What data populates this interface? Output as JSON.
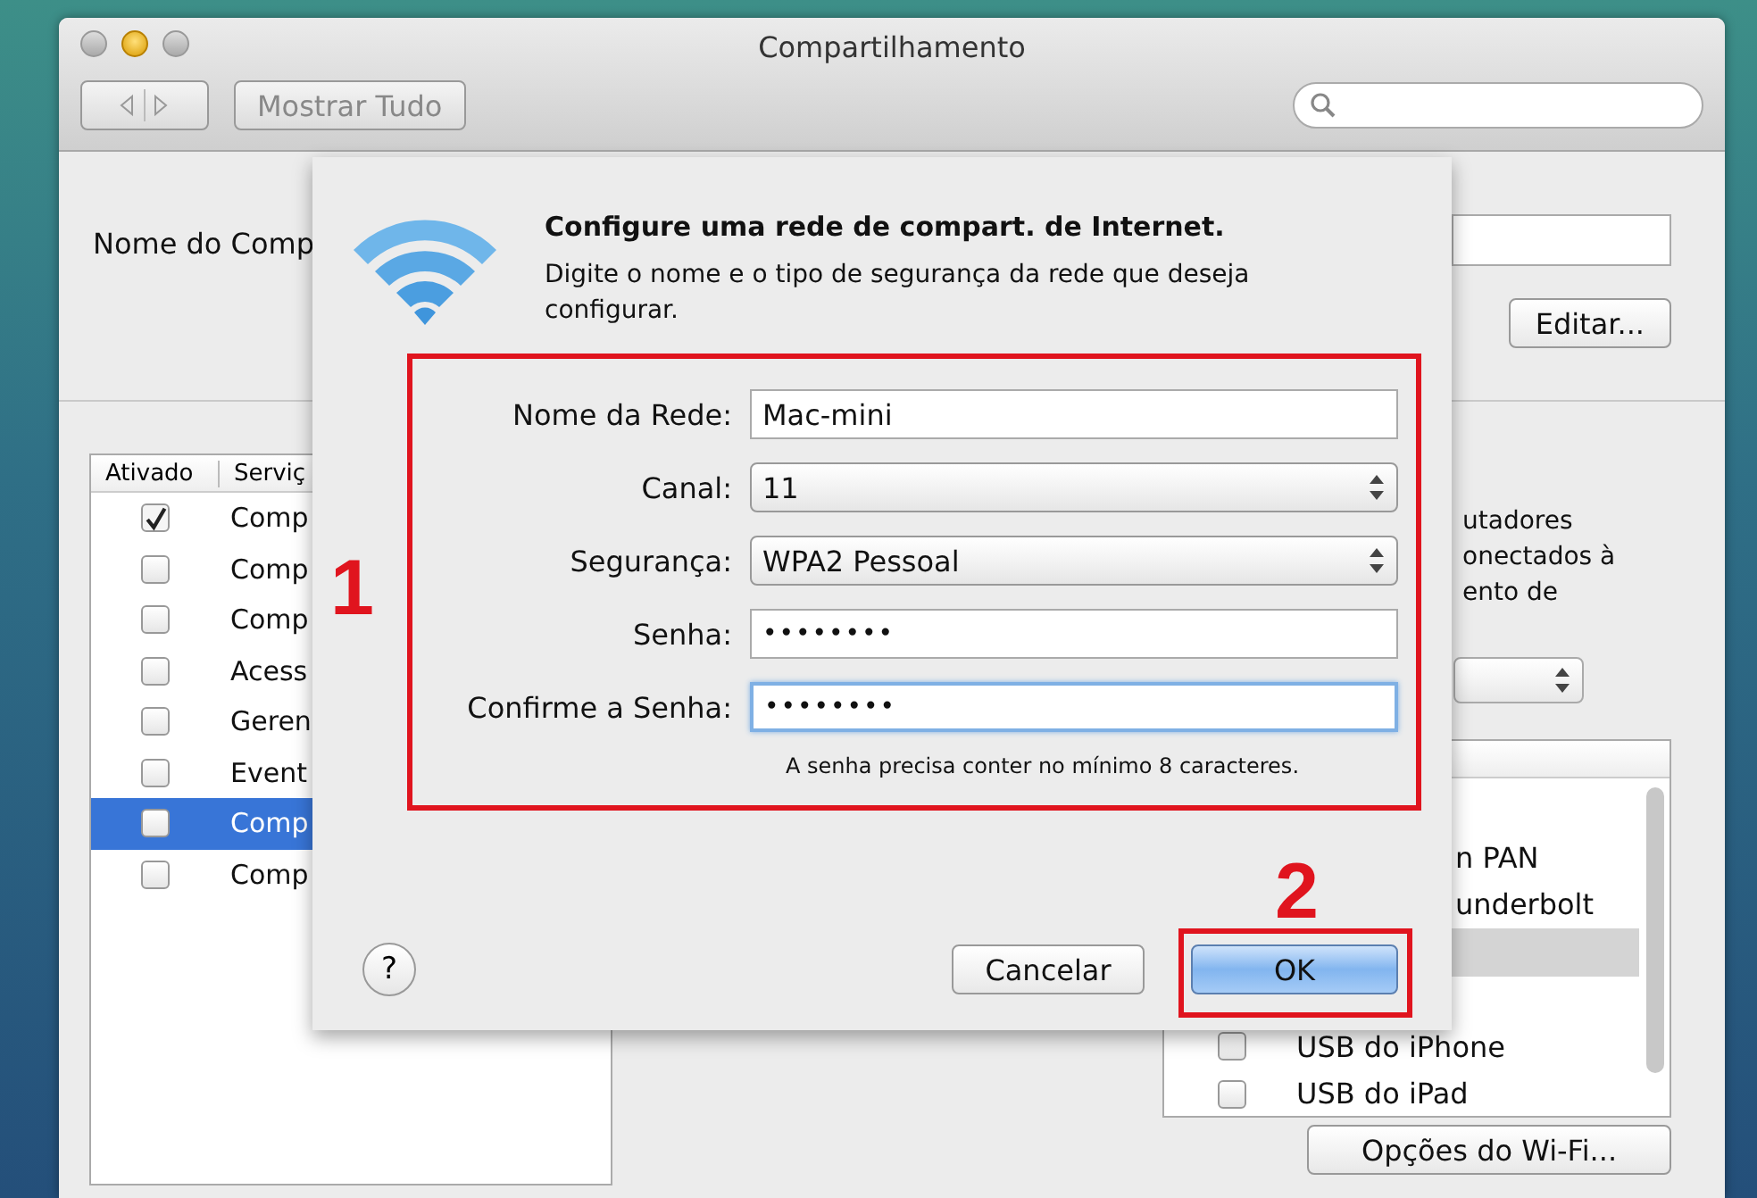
{
  "window": {
    "title": "Compartilhamento",
    "show_all_button": "Mostrar Tudo",
    "computer_name_label": "Nome do Comp",
    "edit_button": "Editar..."
  },
  "services": {
    "columns": [
      "Ativado",
      "Serviç"
    ],
    "rows": [
      {
        "name": "Comp",
        "checked": true,
        "selected": false
      },
      {
        "name": "Comp",
        "checked": false,
        "selected": false
      },
      {
        "name": "Comp",
        "checked": false,
        "selected": false
      },
      {
        "name": "Acess",
        "checked": false,
        "selected": false
      },
      {
        "name": "Geren",
        "checked": false,
        "selected": false
      },
      {
        "name": "Event",
        "checked": false,
        "selected": false
      },
      {
        "name": "Comp",
        "checked": false,
        "selected": true
      },
      {
        "name": "Comp",
        "checked": false,
        "selected": false
      }
    ]
  },
  "detail": {
    "description_lines": [
      "utadores",
      "onectados à",
      "ento de"
    ],
    "ports": [
      {
        "kind": "cut",
        "name": "n PAN",
        "selected": false
      },
      {
        "kind": "cut",
        "name": "underbolt",
        "selected": false
      },
      {
        "kind": "cut",
        "selected": true
      },
      {
        "kind": "cut",
        "selected": false
      },
      {
        "kind": "full",
        "name": "USB do iPhone",
        "checked": false,
        "selected": false
      },
      {
        "kind": "full",
        "name": "USB do iPad",
        "checked": false,
        "selected": false
      }
    ],
    "wifi_options_button": "Opções do Wi-Fi..."
  },
  "sheet": {
    "title": "Configure uma rede de compart. de Internet.",
    "subtitle": "Digite o nome e o tipo de segurança da rede que deseja configurar.",
    "fields": [
      {
        "kind": "text",
        "label": "Nome da Rede:",
        "value": "Mac-mini",
        "focused": false
      },
      {
        "kind": "popup",
        "label": "Canal:",
        "value": "11"
      },
      {
        "kind": "popup",
        "label": "Segurança:",
        "value": "WPA2 Pessoal"
      },
      {
        "kind": "password",
        "label": "Senha:",
        "value": "••••••••",
        "focused": false
      },
      {
        "kind": "password",
        "label": "Confirme a Senha:",
        "value": "••••••••",
        "focused": true
      }
    ],
    "hint": "A senha precisa conter no mínimo 8 caracteres.",
    "help_button": "?",
    "cancel_button": "Cancelar",
    "ok_button": "OK"
  },
  "annotations": [
    {
      "label": "1"
    },
    {
      "label": "2"
    }
  ]
}
